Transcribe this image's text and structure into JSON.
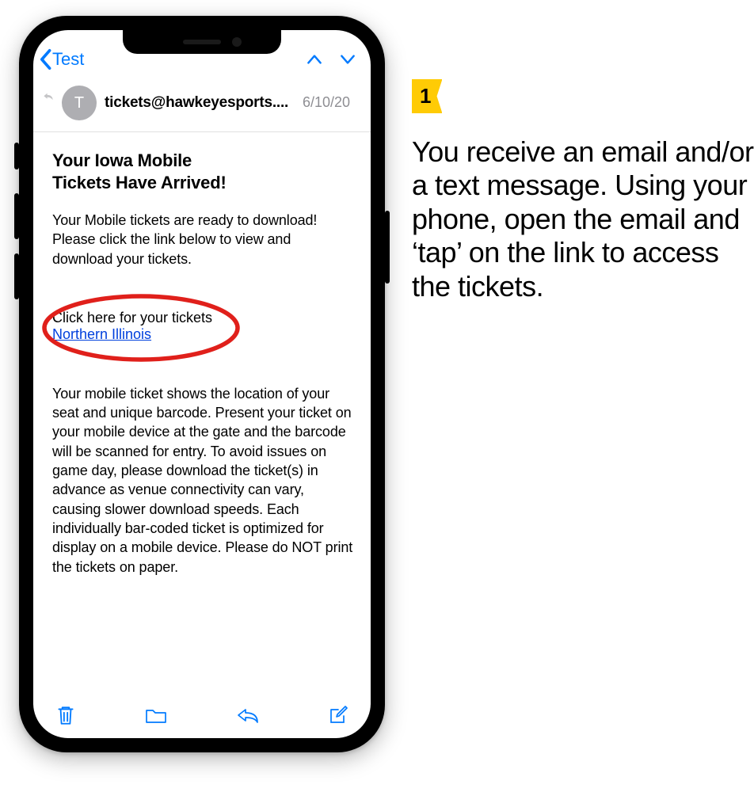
{
  "nav": {
    "back_label": "Test"
  },
  "message": {
    "avatar_initial": "T",
    "sender": "tickets@hawkeyesports....",
    "date": "6/10/20",
    "subject_line1": "Your Iowa Mobile",
    "subject_line2": "Tickets Have Arrived!",
    "intro": "Your Mobile tickets are ready to download! Please click the link below to view and download your tickets.",
    "link_prompt": "Click here for your tickets",
    "link_text": "Northern Illinois",
    "rest": "Your mobile ticket shows the location of your seat and unique barcode. Present your ticket on your mobile device at the gate and the barcode will be scanned for entry. To avoid issues on game day, please download the ticket(s) in advance as venue connectivity can vary, causing slower download speeds. Each individually bar-coded ticket is optimized for display on a mobile device. Please do NOT print the tickets on paper."
  },
  "step": {
    "number": "1",
    "text": "You receive an email and/or a text message. Using your phone, open the email and ‘tap’ on the link to access the tickets."
  }
}
